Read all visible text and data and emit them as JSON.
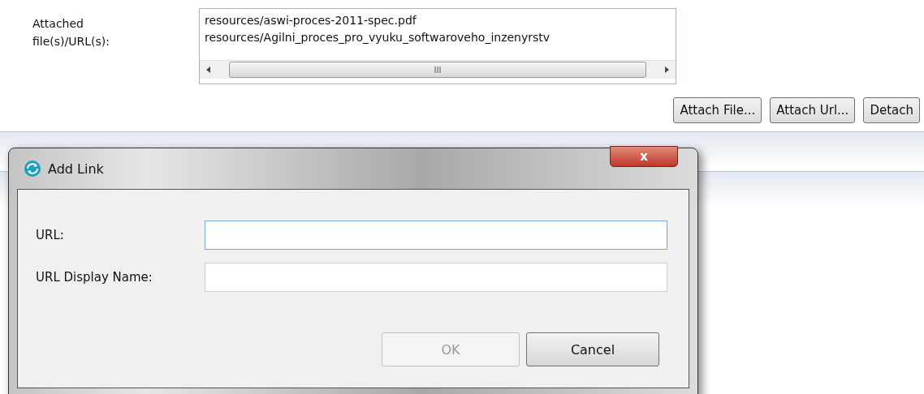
{
  "attachments": {
    "label": "Attached file(s)/URL(s):",
    "items": [
      "resources/aswi-proces-2011-spec.pdf",
      "resources/Agilni_proces_pro_vyuku_softwaroveho_inzenyrstv"
    ]
  },
  "buttons": [
    {
      "label": "Attach File..."
    },
    {
      "label": "Attach Url..."
    },
    {
      "label": "Detach"
    }
  ],
  "dialog": {
    "title": "Add Link",
    "close": "x",
    "fields": [
      {
        "label": "URL:",
        "focused": true
      },
      {
        "label": "URL Display Name:",
        "focused": false
      }
    ],
    "buttons": [
      {
        "label": "OK",
        "disabled": true
      },
      {
        "label": "Cancel",
        "disabled": false
      }
    ]
  }
}
